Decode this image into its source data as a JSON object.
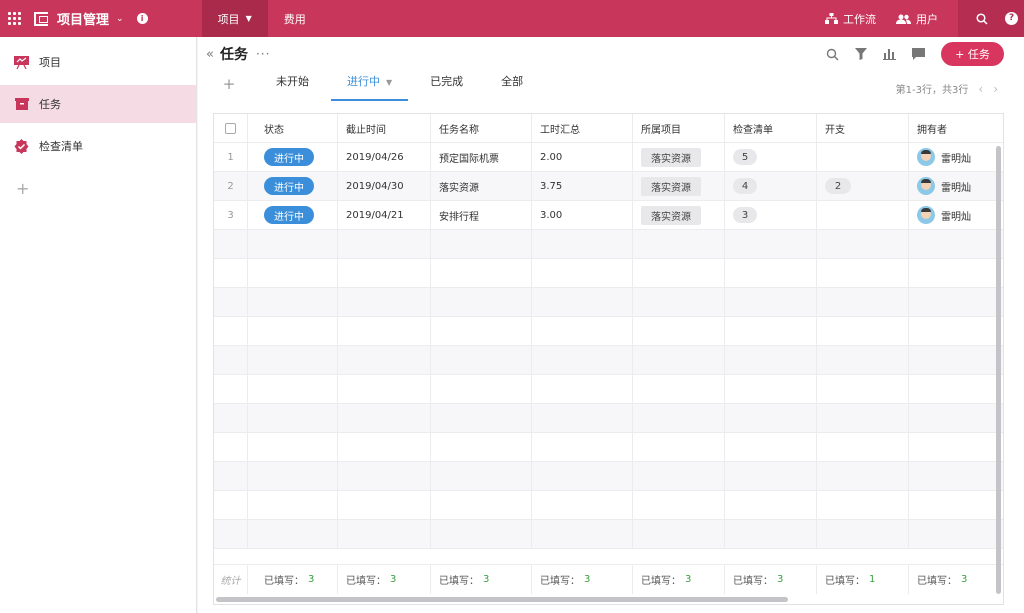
{
  "topbar": {
    "app_title": "项目管理",
    "tabs": [
      {
        "label": "项目",
        "active": true
      },
      {
        "label": "费用",
        "active": false
      }
    ],
    "workflow_label": "工作流",
    "users_label": "用户",
    "help_label": "?",
    "info_label": "i",
    "accent": "#c8365b"
  },
  "sidebar": {
    "items": [
      {
        "label": "项目",
        "icon": "chart-board-icon"
      },
      {
        "label": "任务",
        "icon": "inbox-icon",
        "active": true
      },
      {
        "label": "检查清单",
        "icon": "check-badge-icon"
      }
    ],
    "add_label": "+"
  },
  "view": {
    "title": "任务",
    "more": "···",
    "add_task_label": "+ 任务",
    "tab_add": "+",
    "tabs": [
      {
        "label": "未开始",
        "active": false
      },
      {
        "label": "进行中",
        "active": true
      },
      {
        "label": "已完成",
        "active": false
      },
      {
        "label": "全部",
        "active": false
      }
    ],
    "pager": "第1-3行，共3行"
  },
  "table": {
    "columns": [
      "状态",
      "截止时间",
      "任务名称",
      "工时汇总",
      "所属项目",
      "检查清单",
      "开支",
      "拥有者"
    ],
    "rows": [
      {
        "num": "1",
        "status": "进行中",
        "due": "2019/04/26",
        "name": "预定国际机票",
        "hours": "2.00",
        "project": "落实资源",
        "checklist": "5",
        "expense": "",
        "owner": "雷明灿"
      },
      {
        "num": "2",
        "status": "进行中",
        "due": "2019/04/30",
        "name": "落实资源",
        "hours": "3.75",
        "project": "落实资源",
        "checklist": "4",
        "expense": "2",
        "owner": "雷明灿"
      },
      {
        "num": "3",
        "status": "进行中",
        "due": "2019/04/21",
        "name": "安排行程",
        "hours": "3.00",
        "project": "落实资源",
        "checklist": "3",
        "expense": "",
        "owner": "雷明灿"
      }
    ],
    "footer": {
      "label": "统计",
      "prefix": "已填写：",
      "values": [
        "3",
        "3",
        "3",
        "3",
        "3",
        "3",
        "1",
        "3"
      ]
    }
  }
}
